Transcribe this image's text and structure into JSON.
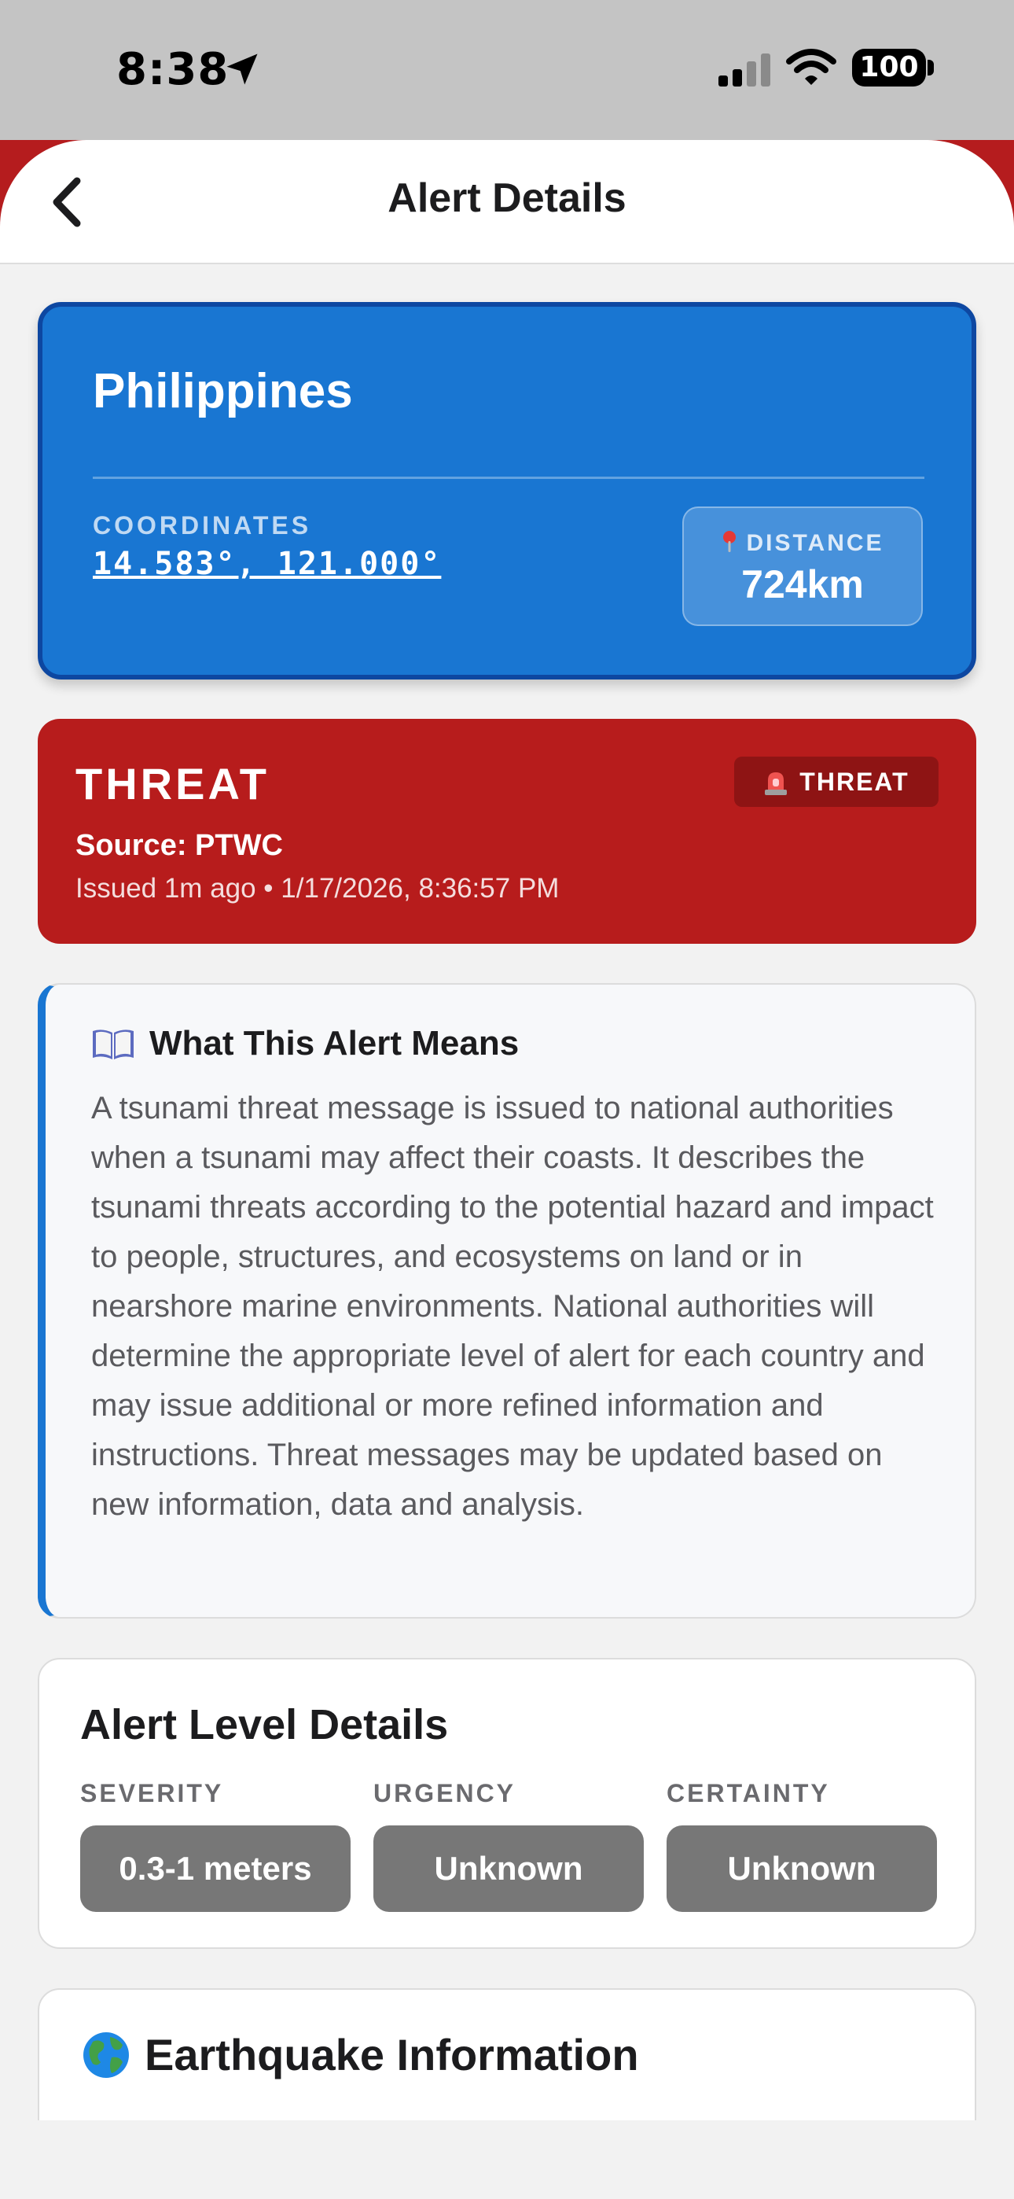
{
  "status_bar": {
    "time": "8:38",
    "battery": "100"
  },
  "header": {
    "title": "Alert Details"
  },
  "location": {
    "name": "Philippines",
    "coordinates_label": "COORDINATES",
    "coordinates": "14.583°, 121.000°",
    "distance_label": "DISTANCE",
    "distance": "724km"
  },
  "threat": {
    "title": "THREAT",
    "badge": "THREAT",
    "source": "Source: PTWC",
    "issued": "Issued 1m ago • 1/17/2026, 8:36:57 PM"
  },
  "meaning": {
    "title": "What This Alert Means",
    "text": "A tsunami threat message is issued to national authorities when a tsunami may affect their coasts. It describes the tsunami threats according to the potential hazard and impact to people, structures, and ecosystems on land or in nearshore marine environments. National authorities will determine the appropriate level of alert for each country and may issue additional or more refined information and instructions. Threat messages may be updated based on new information, data and analysis."
  },
  "alert_level": {
    "title": "Alert Level Details",
    "items": [
      {
        "label": "SEVERITY",
        "value": "0.3-1 meters"
      },
      {
        "label": "URGENCY",
        "value": "Unknown"
      },
      {
        "label": "CERTAINTY",
        "value": "Unknown"
      }
    ]
  },
  "earthquake": {
    "title": "Earthquake Information"
  },
  "colors": {
    "location_card": "#1976d2",
    "threat_card": "#b71c1c",
    "accent_border": "#1976d2",
    "pill": "#777777"
  }
}
